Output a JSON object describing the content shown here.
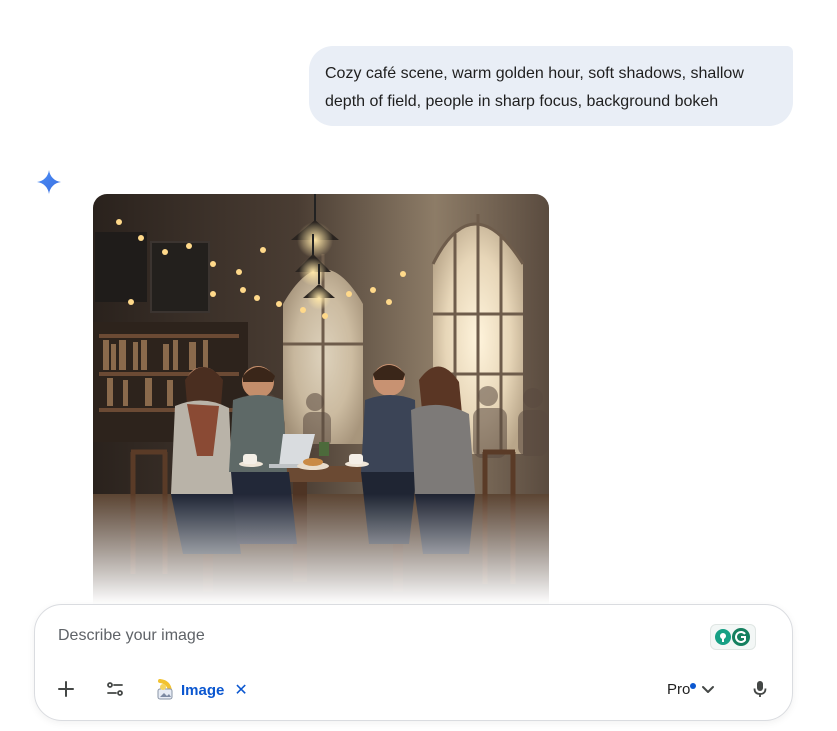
{
  "conversation": {
    "user_message": "Cozy café scene, warm golden hour, soft shadows, shallow depth of field, people in sharp focus, background bokeh",
    "response_image_alt": "Generated image of four friends laughing around a wooden café table under warm pendant lights"
  },
  "composer": {
    "placeholder": "Describe your image",
    "value": "",
    "tool_chip_label": "Image",
    "model_label": "Pro"
  },
  "icons": {
    "assistant": "gemini-spark-icon",
    "add": "plus-icon",
    "tools": "tools-icon",
    "tool_chip": "banana-image-icon",
    "remove_chip": "close-icon",
    "model_dropdown": "chevron-down-icon",
    "mic": "microphone-icon",
    "extension": "grammarly-icon"
  },
  "colors": {
    "user_bubble": "#e9eef6",
    "accent_blue": "#0b57d0",
    "spark_blue": "#4285f4"
  }
}
